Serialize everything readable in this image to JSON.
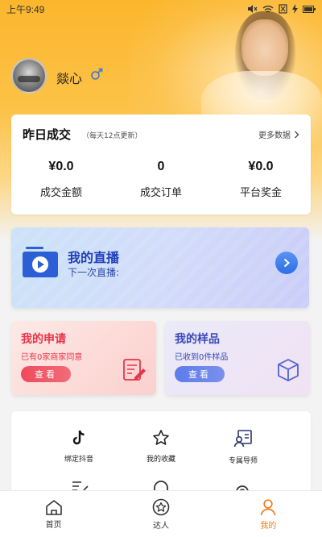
{
  "status_bar": {
    "time": "上午9:49",
    "icons": [
      "mute-icon",
      "wifi-icon",
      "sim-off-icon",
      "charging-icon",
      "battery-icon"
    ]
  },
  "profile": {
    "username": "燚心",
    "gender_icon": "male-icon"
  },
  "stats": {
    "title": "昨日成交",
    "subtitle": "（每天12点更新）",
    "more_label": "更多数据",
    "items": [
      {
        "value": "¥0.0",
        "label": "成交金额"
      },
      {
        "value": "0",
        "label": "成交订单"
      },
      {
        "value": "¥0.0",
        "label": "平台奖金"
      }
    ]
  },
  "live": {
    "title": "我的直播",
    "subtitle": "下一次直播:",
    "icon": "live-video-icon"
  },
  "apply": {
    "title": "我的申请",
    "subtitle": "已有0家商家同意",
    "button": "查看",
    "icon": "edit-form-icon",
    "color": "#e8344a"
  },
  "sample": {
    "title": "我的样品",
    "subtitle": "已收到0件样品",
    "button": "查看",
    "icon": "box-icon",
    "color": "#3b48b7"
  },
  "menu": {
    "items": [
      {
        "label": "绑定抖音",
        "icon": "tiktok-icon"
      },
      {
        "label": "我的收藏",
        "icon": "star-icon"
      },
      {
        "label": "专属导师",
        "icon": "mentor-icon"
      }
    ],
    "partial_icons": [
      "edit-icon",
      "headset-icon",
      "settings-icon"
    ]
  },
  "tabbar": {
    "items": [
      {
        "label": "首页",
        "icon": "home-icon",
        "active": false
      },
      {
        "label": "达人",
        "icon": "star-circle-icon",
        "active": false
      },
      {
        "label": "我的",
        "icon": "person-icon",
        "active": true
      }
    ],
    "active_color": "#f07c1c"
  }
}
